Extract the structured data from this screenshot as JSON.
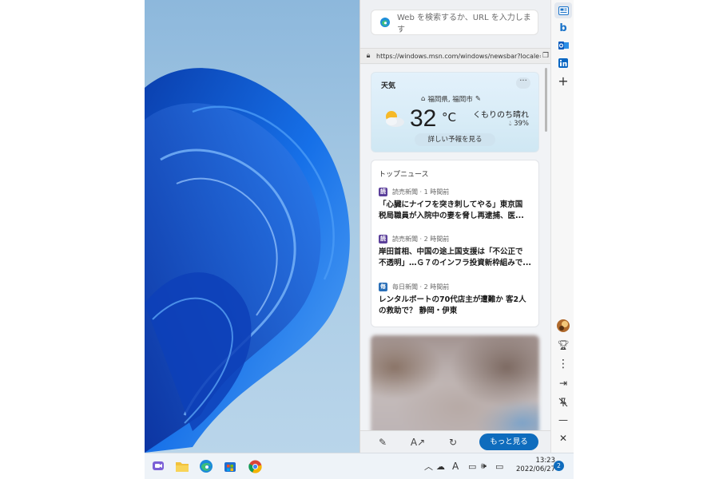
{
  "search": {
    "placeholder": "Web を検索するか、URL を入力します"
  },
  "address": {
    "url": "https://windows.msn.com/windows/newsbar?locale=ja"
  },
  "weather": {
    "title": "天気",
    "location": "福岡県, 福岡市",
    "temperature": "32",
    "unit": "°C",
    "condition": "くもりのち晴れ",
    "humidity": "39%",
    "details_button": "詳しい予報を見る",
    "more_label": "···"
  },
  "news": {
    "title": "トップニュース",
    "items": [
      {
        "source": "読売新聞 · 1 時間前",
        "logo": "読",
        "logo_color": "#5b3f9a",
        "headline1": "「心臓にナイフを突き刺してやる」東京国",
        "headline2": "税局職員が入院中の妻を脅し再逮捕、医..."
      },
      {
        "source": "読売新聞 · 2 時間前",
        "logo": "読",
        "logo_color": "#5b3f9a",
        "headline1": "岸田首相、中国の途上国支援は「不公正で",
        "headline2": "不透明」…Ｇ７のインフラ投資新枠組みで..."
      },
      {
        "source": "毎日新聞 · 2 時間前",
        "logo": "毎",
        "logo_color": "#2a6fb7",
        "headline1": "レンタルボートの70代店主が遭難か 客2人",
        "headline2": "の救助で？ 静岡・伊東"
      }
    ]
  },
  "bottom": {
    "more_button": "もっと見る"
  },
  "taskbar": {
    "time": "13:23",
    "date": "2022/06/27",
    "notification_count": "2",
    "ime_label": "A"
  },
  "colors": {
    "accent": "#0f6cbd",
    "wallpaper_bg": "#9fc3df"
  },
  "icons": [
    "edge-icon",
    "lock-icon",
    "copy-icon",
    "home-icon",
    "pencil-icon",
    "drop-icon",
    "pen-icon",
    "text-size-icon",
    "refresh-icon",
    "news-sidebar-icon",
    "bing-icon",
    "outlook-icon",
    "linkedin-icon",
    "plus-icon",
    "avatar",
    "trophy-icon",
    "more-vertical-icon",
    "dock-icon",
    "unpin-icon",
    "minimize-icon",
    "close-icon"
  ]
}
